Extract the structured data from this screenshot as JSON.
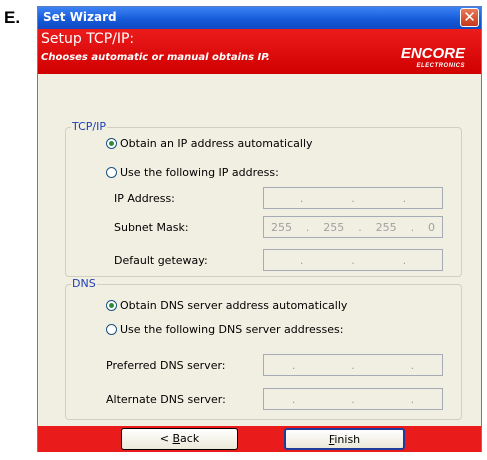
{
  "step_letter": "E.",
  "window": {
    "title": "Set Wizard"
  },
  "header": {
    "title": "Setup TCP/IP:",
    "subtitle": "Chooses automatic or manual obtains IP.",
    "logo_text": "ENCORE",
    "logo_sub": "ELECTRONICS"
  },
  "tcpip": {
    "group_label": "TCP/IP",
    "radio_auto": "Obtain an IP address automatically",
    "radio_manual": "Use the following IP address:",
    "auto_selected": true,
    "ip_label": "IP Address:",
    "ip_value": [
      "",
      "",
      "",
      ""
    ],
    "mask_label": "Subnet Mask:",
    "mask_value": [
      "255",
      "255",
      "255",
      "0"
    ],
    "gateway_label": "Default geteway:",
    "gateway_value": [
      "",
      "",
      "",
      ""
    ]
  },
  "dns": {
    "group_label": "DNS",
    "radio_auto": "Obtain DNS server address automatically",
    "radio_manual": "Use the following DNS server addresses:",
    "auto_selected": true,
    "preferred_label": "Preferred DNS server:",
    "alternate_label": "Alternate DNS server:"
  },
  "footer": {
    "back_prefix": "< ",
    "back_hotkey": "B",
    "back_rest": "ack",
    "finish_hotkey": "F",
    "finish_rest": "inish"
  }
}
